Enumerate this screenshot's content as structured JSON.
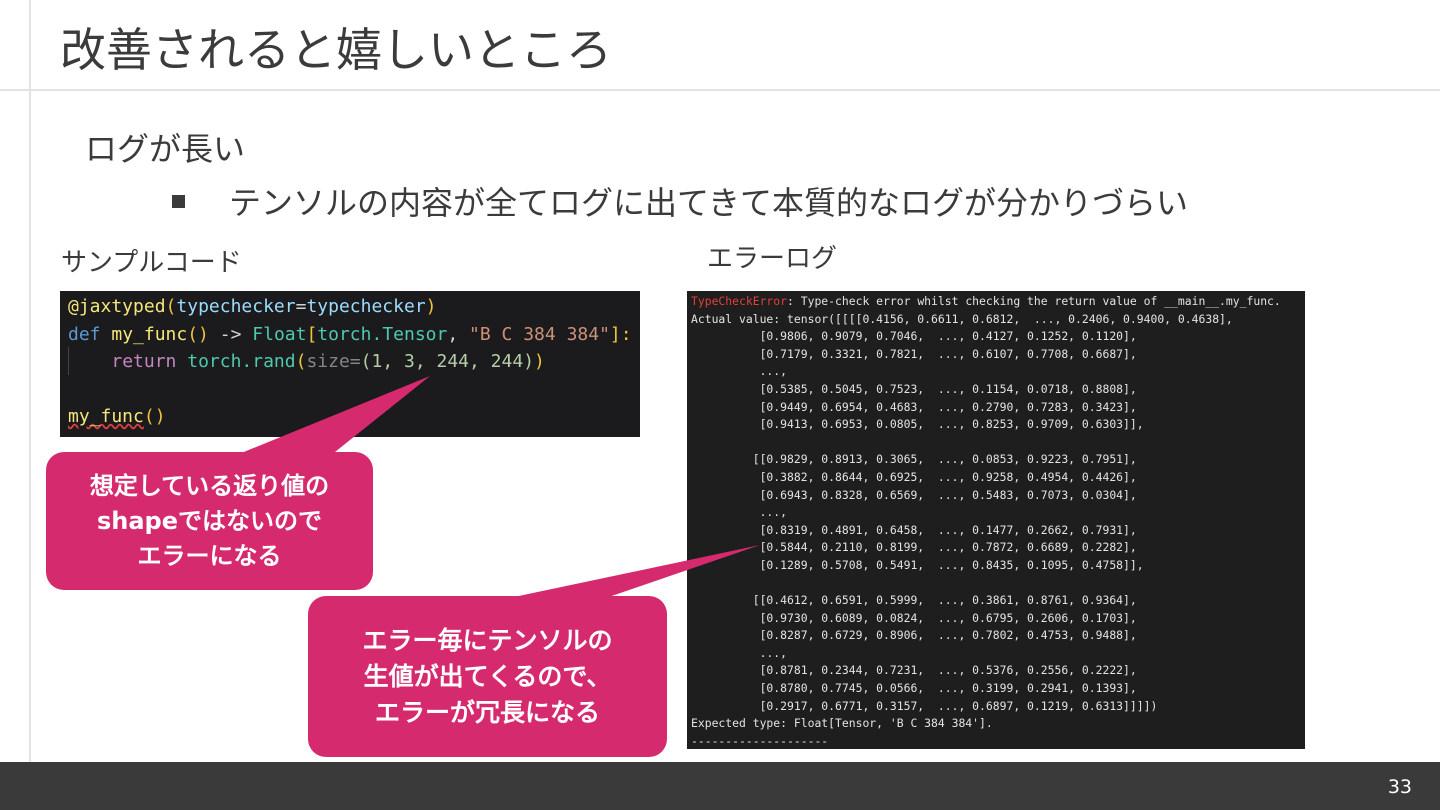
{
  "slide": {
    "title": "改善されると嬉しいところ",
    "bullet1": "ログが長い",
    "bullet2": "テンソルの内容が全てログに出てきて本質的なログが分かりづらい",
    "sample_label": "サンプルコード",
    "error_label": "エラーログ",
    "page_number": "33"
  },
  "code": {
    "line1": {
      "decorator": "@jaxtyped",
      "open": "(",
      "kw": "typechecker",
      "eq": "=",
      "val": "typechecker",
      "close": ")"
    },
    "line2": {
      "def": "def",
      "name": "my_func",
      "paren": "()",
      "arrow": " -> ",
      "type": "Float",
      "ob": "[",
      "mod": "torch.Tensor",
      "comma": ", ",
      "str": "\"B C 384 384\"",
      "cb": "]:"
    },
    "line3": {
      "ret": "return",
      "call": "torch.rand",
      "op": "(",
      "param": "size=",
      "tuple": "(1, 3, 244, 244)",
      "cp": ")"
    },
    "line5": {
      "call": "my_func",
      "paren": "()"
    }
  },
  "log": {
    "error_name": "TypeCheckError",
    "error_msg": ": Type-check error whilst checking the return value of __main__.my_func.",
    "lines": [
      "Actual value: tensor([[[[0.4156, 0.6611, 0.6812,  ..., 0.2406, 0.9400, 0.4638],",
      "          [0.9806, 0.9079, 0.7046,  ..., 0.4127, 0.1252, 0.1120],",
      "          [0.7179, 0.3321, 0.7821,  ..., 0.6107, 0.7708, 0.6687],",
      "          ...,",
      "          [0.5385, 0.5045, 0.7523,  ..., 0.1154, 0.0718, 0.8808],",
      "          [0.9449, 0.6954, 0.4683,  ..., 0.2790, 0.7283, 0.3423],",
      "          [0.9413, 0.6953, 0.0805,  ..., 0.8253, 0.9709, 0.6303]],",
      "",
      "         [[0.9829, 0.8913, 0.3065,  ..., 0.0853, 0.9223, 0.7951],",
      "          [0.3882, 0.8644, 0.6925,  ..., 0.9258, 0.4954, 0.4426],",
      "          [0.6943, 0.8328, 0.6569,  ..., 0.5483, 0.7073, 0.0304],",
      "          ...,",
      "          [0.8319, 0.4891, 0.6458,  ..., 0.1477, 0.2662, 0.7931],",
      "          [0.5844, 0.2110, 0.8199,  ..., 0.7872, 0.6689, 0.2282],",
      "          [0.1289, 0.5708, 0.5491,  ..., 0.8435, 0.1095, 0.4758]],",
      "",
      "         [[0.4612, 0.6591, 0.5999,  ..., 0.3861, 0.8761, 0.9364],",
      "          [0.9730, 0.6089, 0.0824,  ..., 0.6795, 0.2606, 0.1703],",
      "          [0.8287, 0.6729, 0.8906,  ..., 0.7802, 0.4753, 0.9488],",
      "          ...,",
      "          [0.8781, 0.2344, 0.7231,  ..., 0.5376, 0.2556, 0.2222],",
      "          [0.8780, 0.7745, 0.0566,  ..., 0.3199, 0.2941, 0.1393],",
      "          [0.2917, 0.6771, 0.3157,  ..., 0.6897, 0.1219, 0.6313]]]])",
      "Expected type: Float[Tensor, 'B C 384 384'].",
      "--------------------"
    ]
  },
  "callouts": {
    "shape_error": [
      "想定している返り値の",
      "shapeではないので",
      "エラーになる"
    ],
    "verbose": [
      "エラー毎にテンソルの",
      "生値が出てくるので、",
      "エラーが冗長になる"
    ]
  },
  "colors": {
    "callout": "#d62a6e",
    "footer": "#3a3a3a",
    "code_bg": "#1b1b1d",
    "log_bg": "#1e1e1e",
    "error_red": "#e0413a"
  }
}
